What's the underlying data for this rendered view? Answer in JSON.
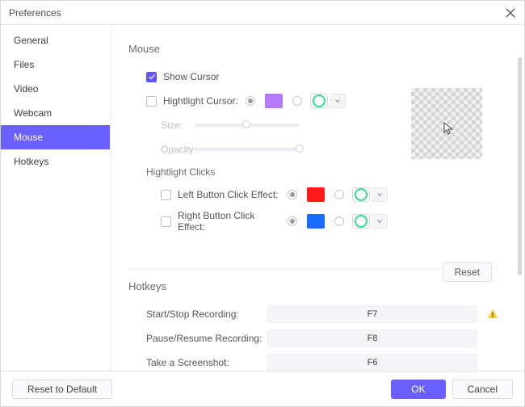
{
  "window": {
    "title": "Preferences"
  },
  "sidebar": {
    "items": [
      {
        "label": "General"
      },
      {
        "label": "Files"
      },
      {
        "label": "Video"
      },
      {
        "label": "Webcam"
      },
      {
        "label": "Mouse"
      },
      {
        "label": "Hotkeys"
      }
    ],
    "active_index": 4
  },
  "mouse": {
    "heading": "Mouse",
    "show_cursor_label": "Show Cursor",
    "highlight_cursor_label": "Hightlight Cursor:",
    "size_label": "Size:",
    "opacity_label": "Opacity:",
    "highlight_clicks_heading": "Hightlight Clicks",
    "left_click_label": "Left Button Click Effect:",
    "right_click_label": "Right Button Click Effect:",
    "reset_label": "Reset",
    "colors": {
      "highlight_swatch": "#b47bff",
      "left_swatch": "#ff1a1a",
      "right_swatch": "#1a6bff"
    },
    "show_cursor_checked": true,
    "highlight_cursor_checked": false,
    "left_click_checked": false,
    "right_click_checked": false,
    "size_value_pct": 45,
    "opacity_value_pct": 100
  },
  "hotkeys": {
    "heading": "Hotkeys",
    "rows": [
      {
        "label": "Start/Stop Recording:",
        "value": "F7",
        "warn": true
      },
      {
        "label": "Pause/Resume Recording:",
        "value": "F8",
        "warn": false
      },
      {
        "label": "Take a Screenshot:",
        "value": "F6",
        "warn": false
      }
    ]
  },
  "footer": {
    "reset_default": "Reset to Default",
    "ok": "OK",
    "cancel": "Cancel"
  }
}
